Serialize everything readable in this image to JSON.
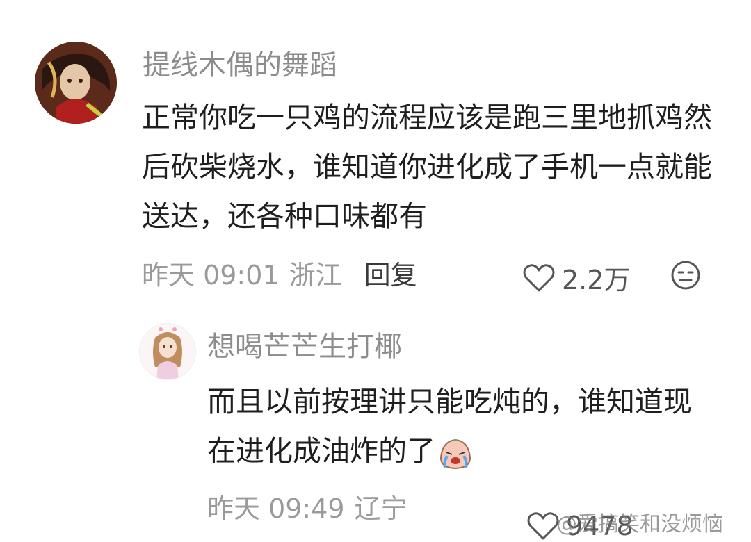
{
  "comments": [
    {
      "username": "提线木偶的舞蹈",
      "text": "正常你吃一只鸡的流程应该是跑三里地抓鸡然后砍柴烧水，谁知道你进化成了手机一点就能送达，还各种口味都有",
      "time": "昨天 09:01",
      "location": "浙江",
      "reply_label": "回复",
      "likes": "2.2万",
      "avatar_icon": "user-avatar-icon"
    }
  ],
  "reply": {
    "username": "想喝芒芒生打椰",
    "text": "而且以前按理讲只能吃炖的，谁知道现在进化成油炸的了",
    "emoji": "crying-face-emoji",
    "time": "昨天 09:49",
    "location": "辽宁",
    "likes": "9478",
    "avatar_icon": "user-avatar-icon"
  },
  "watermark": "@爱搞笑和没烦恼",
  "colors": {
    "username": "#8c8c8c",
    "text": "#1e1e1e",
    "meta": "#9a9a9a"
  }
}
